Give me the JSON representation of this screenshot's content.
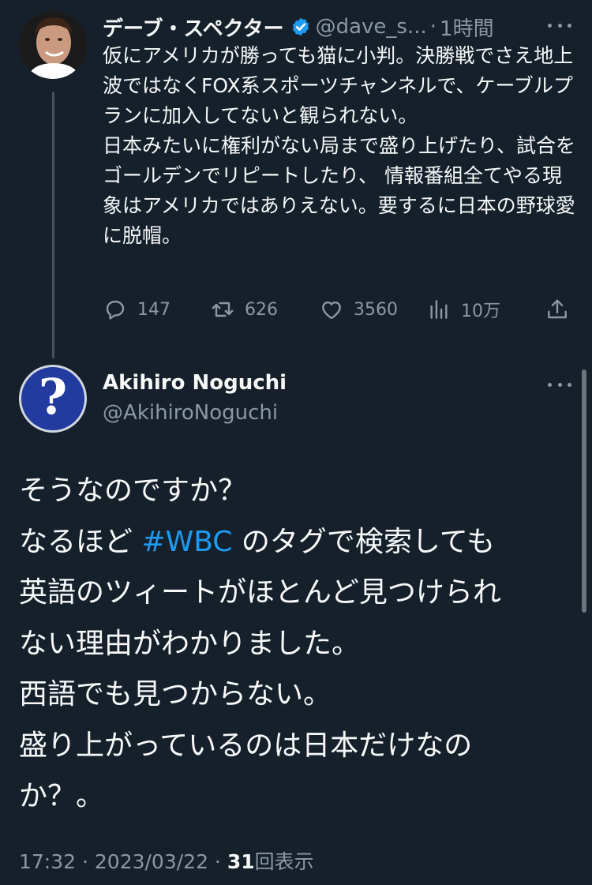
{
  "parent_tweet": {
    "author_name": "デーブ・スペクター",
    "handle": "@dave_s...",
    "separator": "·",
    "time": "1時間",
    "text": "仮にアメリカが勝っても猫に小判。決勝戦でさえ地上波ではなくFOX系スポーツチャンネルで、ケーブルプランに加入してないと観られない。\n日本みたいに権利がない局まで盛り上げたり、試合をゴールデンでリピートしたり、 情報番組全てやる現象はアメリカではありえない。要するに日本の野球愛に脱帽。",
    "replies": "147",
    "retweets": "626",
    "likes": "3560",
    "views": "10万"
  },
  "main_tweet": {
    "author_name": "Akihiro Noguchi",
    "handle": "@AkihiroNoguchi",
    "avatar_glyph": "?",
    "lines": {
      "l1": "そうなのですか？",
      "l2_before": "なるほど ",
      "l2_hashtag": "#WBC",
      "l2_after": " のタグで検索しても",
      "l3": "英語のツィートがほとんど見つけられ",
      "l4": "ない理由がわかりました。",
      "l5": "西語でも見つからない。",
      "l6": "盛り上がっているのは日本だけなの",
      "l7": "か？。"
    },
    "timestamp": "17:32 · 2023/03/22 · ",
    "view_count": "31",
    "view_label": "回表示"
  },
  "colors": {
    "background": "#15202b",
    "text": "#f7f9f9",
    "secondary": "#8b98a5",
    "link": "#1d9bf0",
    "verified": "#1d9bf0"
  },
  "icons": {
    "reply": "speech-bubble-icon",
    "retweet": "retweet-arrows-icon",
    "like": "heart-icon",
    "views": "bar-chart-icon",
    "share": "share-arrow-icon",
    "more": "more-dots-icon",
    "verified": "verified-badge-icon"
  }
}
